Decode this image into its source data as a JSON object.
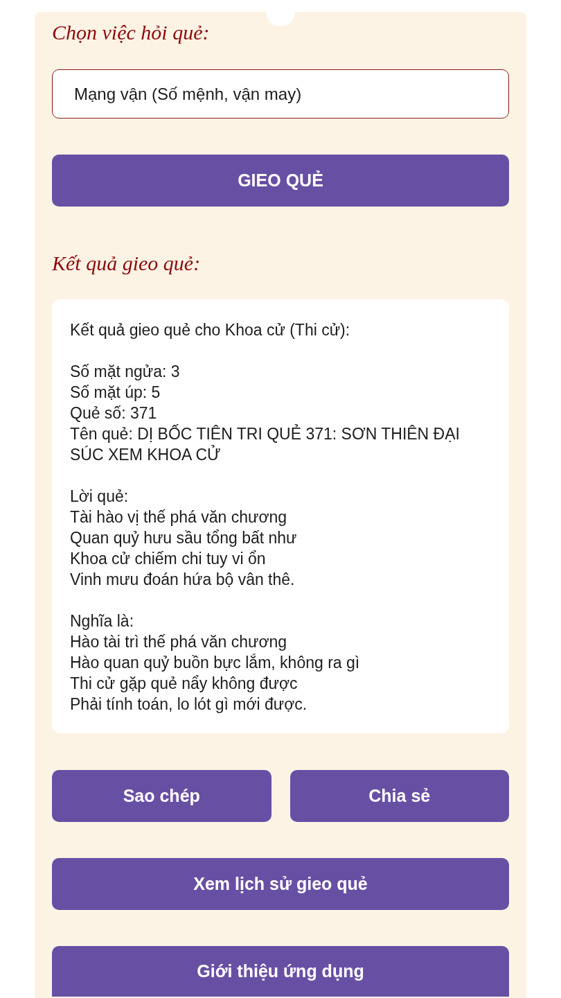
{
  "question_heading": "Chọn việc hỏi quẻ:",
  "question_select": {
    "value": "Mạng vận (Số mệnh, vận may)"
  },
  "cast_button": "GIEO QUẺ",
  "result_heading": "Kết quả gieo quẻ:",
  "result_text": "Kết quả gieo quẻ cho Khoa cử (Thi cử):\n\nSố mặt ngửa: 3\nSố mặt úp: 5\nQuẻ số: 371\nTên quẻ: DỊ BỐC TIÊN TRI QUẺ 371: SƠN THIÊN ĐẠI SÚC XEM KHOA CỬ\n\nLời quẻ:\nTài hào vị thế phá văn chương\nQuan quỷ hưu sầu tổng bất như\nKhoa cử chiếm chi tuy vi ổn\nVinh mưu đoán hứa bộ vân thê.\n\nNghĩa là:\nHào tài trì thế phá văn chương\nHào quan quỷ buồn bực lắm, không ra gì\nThi cử gặp quẻ nẩy không được\nPhải tính toán, lo lót gì mới được.",
  "action_buttons": [
    {
      "label": "Sao chép"
    },
    {
      "label": "Chia sẻ"
    }
  ],
  "history_button": "Xem lịch sử gieo quẻ",
  "about_button": "Giới thiệu ứng dụng"
}
